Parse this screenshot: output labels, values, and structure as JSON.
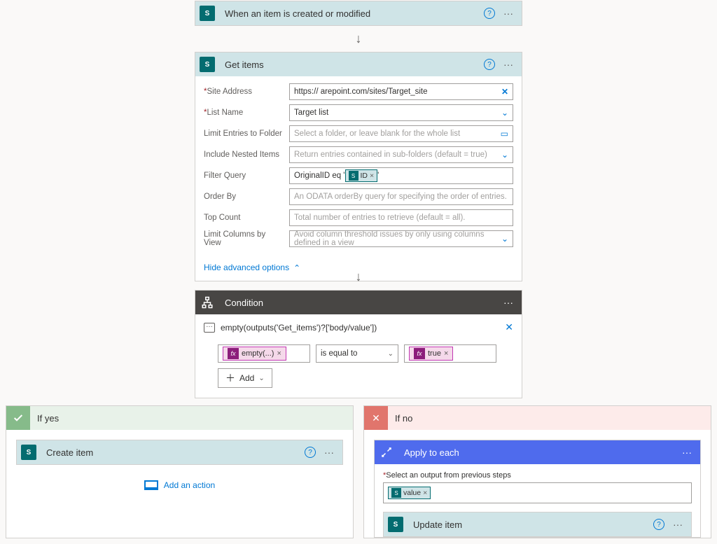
{
  "trigger": {
    "title": "When an item is created or modified"
  },
  "get_items": {
    "title": "Get items",
    "fields": {
      "site_address": {
        "label": "Site Address",
        "value": "https://            arepoint.com/sites/Target_site"
      },
      "list_name": {
        "label": "List Name",
        "value": "Target list"
      },
      "limit_folder": {
        "label": "Limit Entries to Folder",
        "placeholder": "Select a folder, or leave blank for the whole list"
      },
      "nested": {
        "label": "Include Nested Items",
        "value": "Return entries contained in sub-folders (default = true)"
      },
      "filter": {
        "label": "Filter Query",
        "prefix": "OriginalID eq '",
        "token": "ID",
        "suffix": "'"
      },
      "order_by": {
        "label": "Order By",
        "placeholder": "An ODATA orderBy query for specifying the order of entries."
      },
      "top_count": {
        "label": "Top Count",
        "placeholder": "Total number of entries to retrieve (default = all)."
      },
      "limit_cols": {
        "label": "Limit Columns by View",
        "value": "Avoid column threshold issues by only using columns defined in a view"
      }
    },
    "toggle": "Hide advanced options"
  },
  "condition": {
    "title": "Condition",
    "expression": "empty(outputs('Get_items')?['body/value'])",
    "left_token": "empty(...)",
    "comparator": "is equal to",
    "right_token": "true",
    "add": "Add"
  },
  "branches": {
    "yes": {
      "title": "If yes",
      "action1": "Create item",
      "add_action": "Add an action"
    },
    "no": {
      "title": "If no",
      "apply_to_each": {
        "title": "Apply to each",
        "select_label": "Select an output from previous steps",
        "value_token": "value"
      },
      "update": "Update item"
    }
  }
}
